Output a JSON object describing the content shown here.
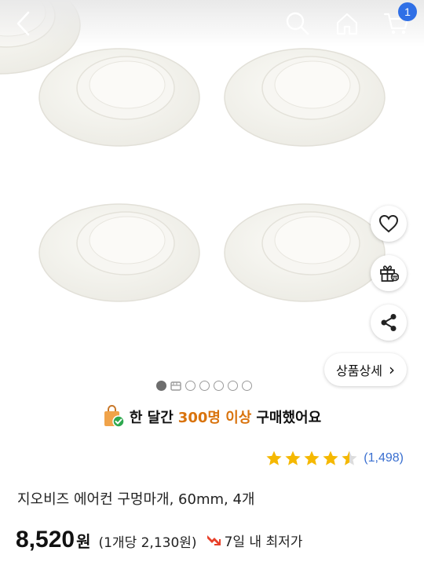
{
  "header": {
    "back_icon": "chevron-left-icon",
    "search_icon": "search-icon",
    "home_icon": "home-icon",
    "cart_icon": "cart-icon",
    "cart_count": "1"
  },
  "gallery": {
    "current_slide": 1,
    "total_dots": 7,
    "video_indicator": "video-icon"
  },
  "side_actions": {
    "wishlist_icon": "heart-icon",
    "gift_icon": "gift-icon",
    "share_icon": "share-icon"
  },
  "detail_button": {
    "label": "상품상세",
    "chevron": "›"
  },
  "purchase_banner": {
    "prefix": "한 달간",
    "highlight": "300명 이상",
    "suffix": "구매했어요"
  },
  "rating": {
    "stars": 4.5,
    "review_count": "(1,498)"
  },
  "product": {
    "title": "지오비즈 에어컨 구멍마개, 60mm, 4개"
  },
  "price": {
    "amount": "8,520",
    "currency": "원",
    "unit_price": "(1개당 2,130원)",
    "lowest_label": "7일 내 최저가"
  },
  "colors": {
    "accent_blue": "#2f6fe6",
    "highlight_orange": "#d9730d",
    "star_yellow": "#f5b800",
    "review_blue": "#3a6fd0"
  }
}
